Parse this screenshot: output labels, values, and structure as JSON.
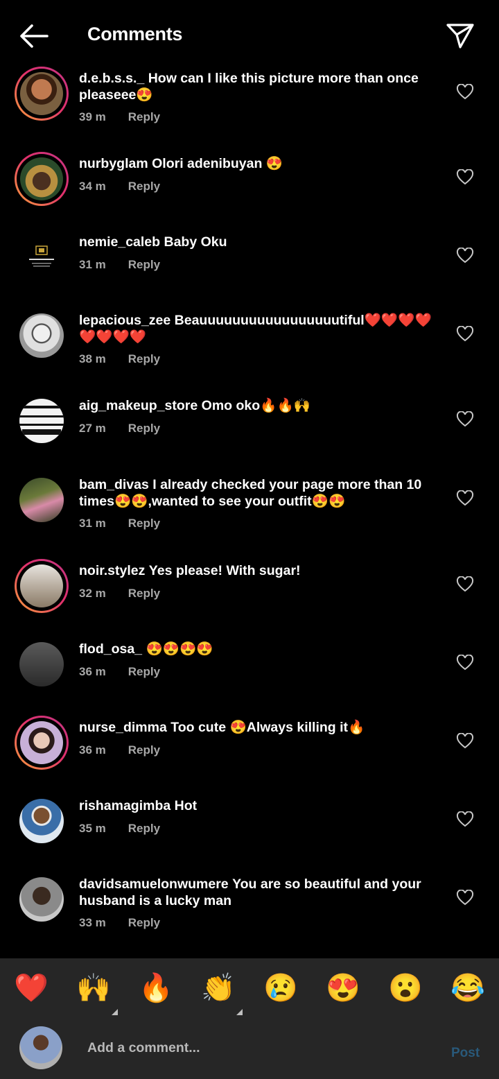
{
  "header": {
    "title": "Comments",
    "back_icon": "back-arrow-icon",
    "share_icon": "paper-plane-icon"
  },
  "comments": [
    {
      "user": "d.e.b.s.s._",
      "text": "How can I like this picture more than once pleaseee😍",
      "time": "39 m",
      "reply": "Reply",
      "ring": true,
      "avatar_color": "#8a5a3c"
    },
    {
      "user": "nurbyglam",
      "text": "Olori adenibuyan 😍",
      "time": "34 m",
      "reply": "Reply",
      "ring": true,
      "avatar_color": "#6b5a2a"
    },
    {
      "user": "nemie_caleb",
      "text": "Baby Oku",
      "time": "31 m",
      "reply": "Reply",
      "ring": false,
      "avatar_color": "#000000"
    },
    {
      "user": "lepacious_zee",
      "text": "Beauuuuuuuuuuuuuuuuutiful❤️❤️❤️❤️❤️❤️❤️❤️",
      "time": "38 m",
      "reply": "Reply",
      "ring": false,
      "avatar_color": "#d8d8d8"
    },
    {
      "user": "aig_makeup_store",
      "text": "Omo oko🔥🔥🙌",
      "time": "27 m",
      "reply": "Reply",
      "ring": false,
      "avatar_color": "#f2f2f2"
    },
    {
      "user": "bam_divas",
      "text": "I already checked your page more than 10 times😍😍,wanted to see your outfit😍😍",
      "time": "31 m",
      "reply": "Reply",
      "ring": false,
      "avatar_color": "#5a6b3a"
    },
    {
      "user": "noir.stylez",
      "text": "Yes please! With sugar!",
      "time": "32 m",
      "reply": "Reply",
      "ring": true,
      "avatar_color": "#bdb3a6"
    },
    {
      "user": "flod_osa_",
      "text": "😍😍😍😍",
      "time": "36 m",
      "reply": "Reply",
      "ring": false,
      "avatar_color": "#3a3a3a"
    },
    {
      "user": "nurse_dimma",
      "text": "Too cute 😍Always killing it🔥",
      "time": "36 m",
      "reply": "Reply",
      "ring": true,
      "avatar_color": "#b8a0c8"
    },
    {
      "user": "rishamagimba",
      "text": "Hot",
      "time": "35 m",
      "reply": "Reply",
      "ring": false,
      "avatar_color": "#3a6ea8"
    },
    {
      "user": "davidsamuelonwumere",
      "text": "You are so beautiful and your husband is a lucky man",
      "time": "33 m",
      "reply": "Reply",
      "ring": false,
      "avatar_color": "#8a8a8a"
    }
  ],
  "emoji_bar": [
    "❤️",
    "🙌",
    "🔥",
    "👏",
    "😢",
    "😍",
    "😮",
    "😂"
  ],
  "composer": {
    "placeholder": "Add a comment...",
    "post_label": "Post"
  },
  "colors": {
    "background": "#000000",
    "bar": "#262626",
    "post": "#29597a",
    "meta": "#a8a8a8"
  }
}
